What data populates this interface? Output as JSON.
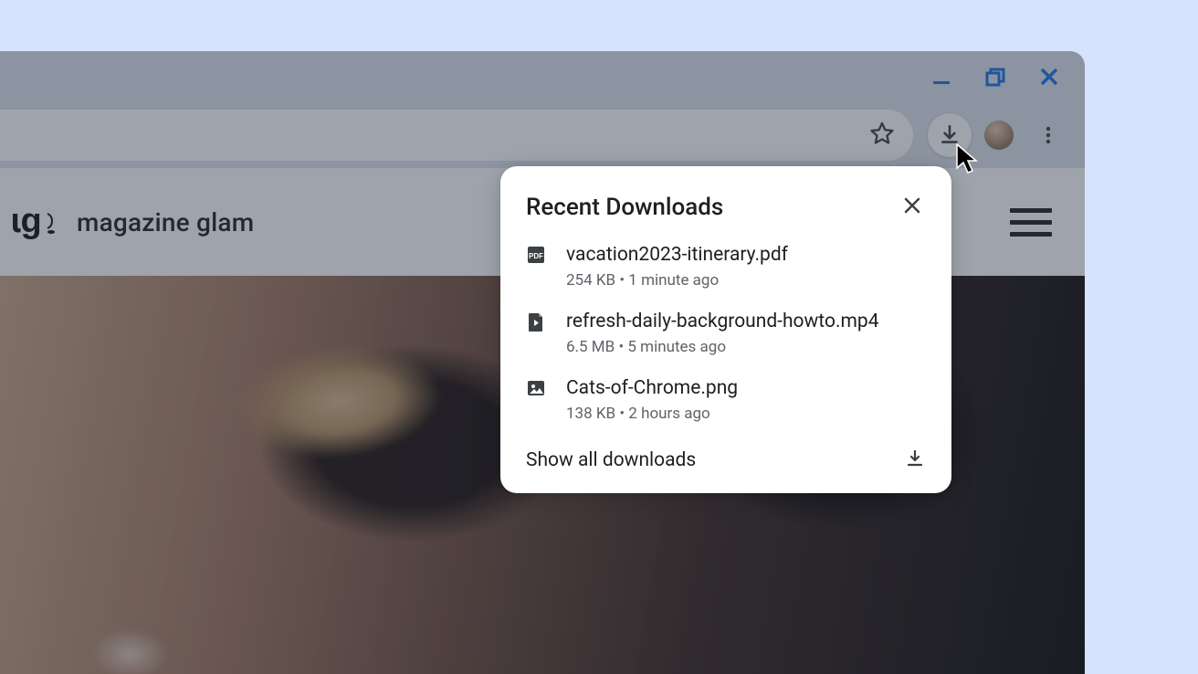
{
  "page": {
    "site_name": "magazine glam"
  },
  "popup": {
    "title": "Recent Downloads",
    "items": [
      {
        "icon": "pdf",
        "name": "vacation2023-itinerary.pdf",
        "meta": "254 KB • 1 minute ago"
      },
      {
        "icon": "video",
        "name": "refresh-daily-background-howto.mp4",
        "meta": "6.5 MB • 5 minutes ago"
      },
      {
        "icon": "image",
        "name": "Cats-of-Chrome.png",
        "meta": "138 KB • 2 hours ago"
      }
    ],
    "show_all_label": "Show all downloads"
  }
}
